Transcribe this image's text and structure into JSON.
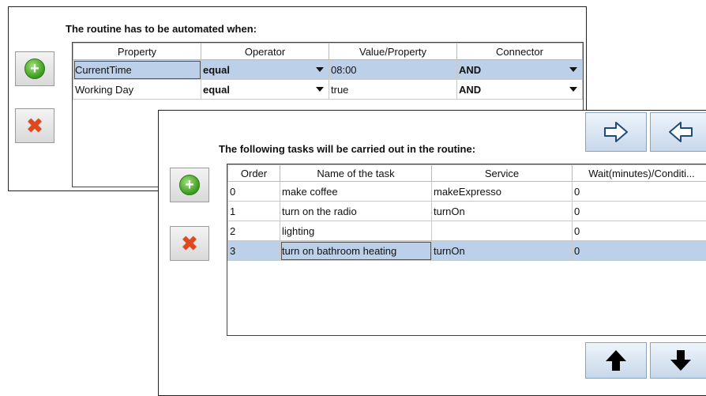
{
  "conditions": {
    "heading": "The routine has to be automated when:",
    "columns": [
      "Property",
      "Operator",
      "Value/Property",
      "Connector"
    ],
    "rows": [
      {
        "property": "CurrentTime",
        "operator": "equal",
        "value": "08:00",
        "connector": "AND",
        "selected": true
      },
      {
        "property": "Working Day",
        "operator": "equal",
        "value": "true",
        "connector": "AND",
        "selected": false
      }
    ]
  },
  "tasks": {
    "heading": "The following tasks will be carried out in the routine:",
    "columns": [
      "Order",
      "Name of the task",
      "Service",
      "Wait(minutes)/Conditi..."
    ],
    "rows": [
      {
        "order": "0",
        "name": "make coffee",
        "service": "makeExpresso",
        "wait": "0",
        "selected": false
      },
      {
        "order": "1",
        "name": "turn on the radio",
        "service": "turnOn",
        "wait": "0",
        "selected": false
      },
      {
        "order": "2",
        "name": "lighting",
        "service": "",
        "wait": "0",
        "selected": false
      },
      {
        "order": "3",
        "name": "turn on bathroom heating",
        "service": "turnOn",
        "wait": "0",
        "selected": true
      }
    ]
  },
  "icons": {
    "add": "plus-circle-icon",
    "delete": "x-icon",
    "next": "arrow-right-icon",
    "prev": "arrow-left-icon",
    "up": "arrow-up-icon",
    "down": "arrow-down-icon"
  },
  "colors": {
    "selection": "#bcd0ea",
    "add_green": "#3b9b1e",
    "delete_orange": "#e0471a"
  }
}
